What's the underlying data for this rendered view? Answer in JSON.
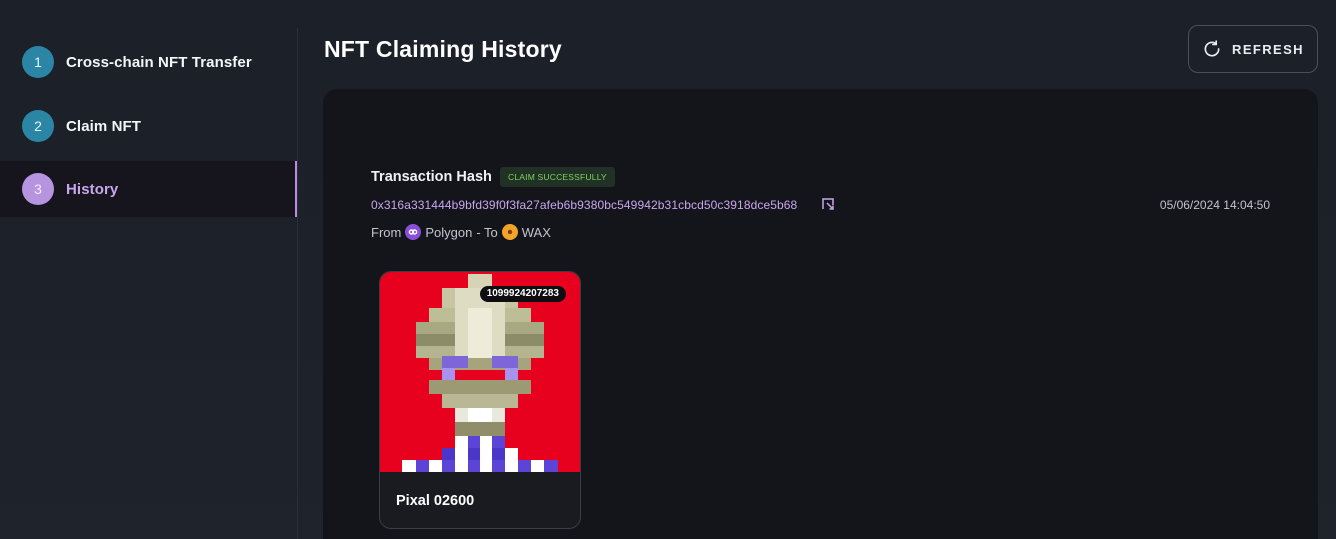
{
  "sidebar": {
    "steps": [
      {
        "number": "1",
        "label": "Cross-chain NFT Transfer"
      },
      {
        "number": "2",
        "label": "Claim NFT"
      },
      {
        "number": "3",
        "label": "History"
      }
    ],
    "active_step": "3"
  },
  "header": {
    "title": "NFT Claiming History",
    "refresh_label": "REFRESH",
    "refresh_icon": "refresh-icon"
  },
  "transaction": {
    "title": "Transaction Hash",
    "status_badge": "CLAIM SUCCESSFULLY",
    "hash": "0x316a331444b9bfd39f0f3fa27afeb6b9380bc549942b31cbcd50c3918dce5b68",
    "copy_icon": "copy-link-icon",
    "datetime": "05/06/2024 14:04:50",
    "route": {
      "from_prefix": "From",
      "from_chain": "Polygon",
      "separator": "- To",
      "to_chain": "WAX"
    }
  },
  "nft": {
    "id": "1099924207283",
    "name": "Pixal 02600"
  },
  "colors": {
    "accent_purple": "#c9a6ee",
    "step_blue": "#2b86a6",
    "success_green": "#79d65c",
    "nft_background": "#e8001f"
  }
}
